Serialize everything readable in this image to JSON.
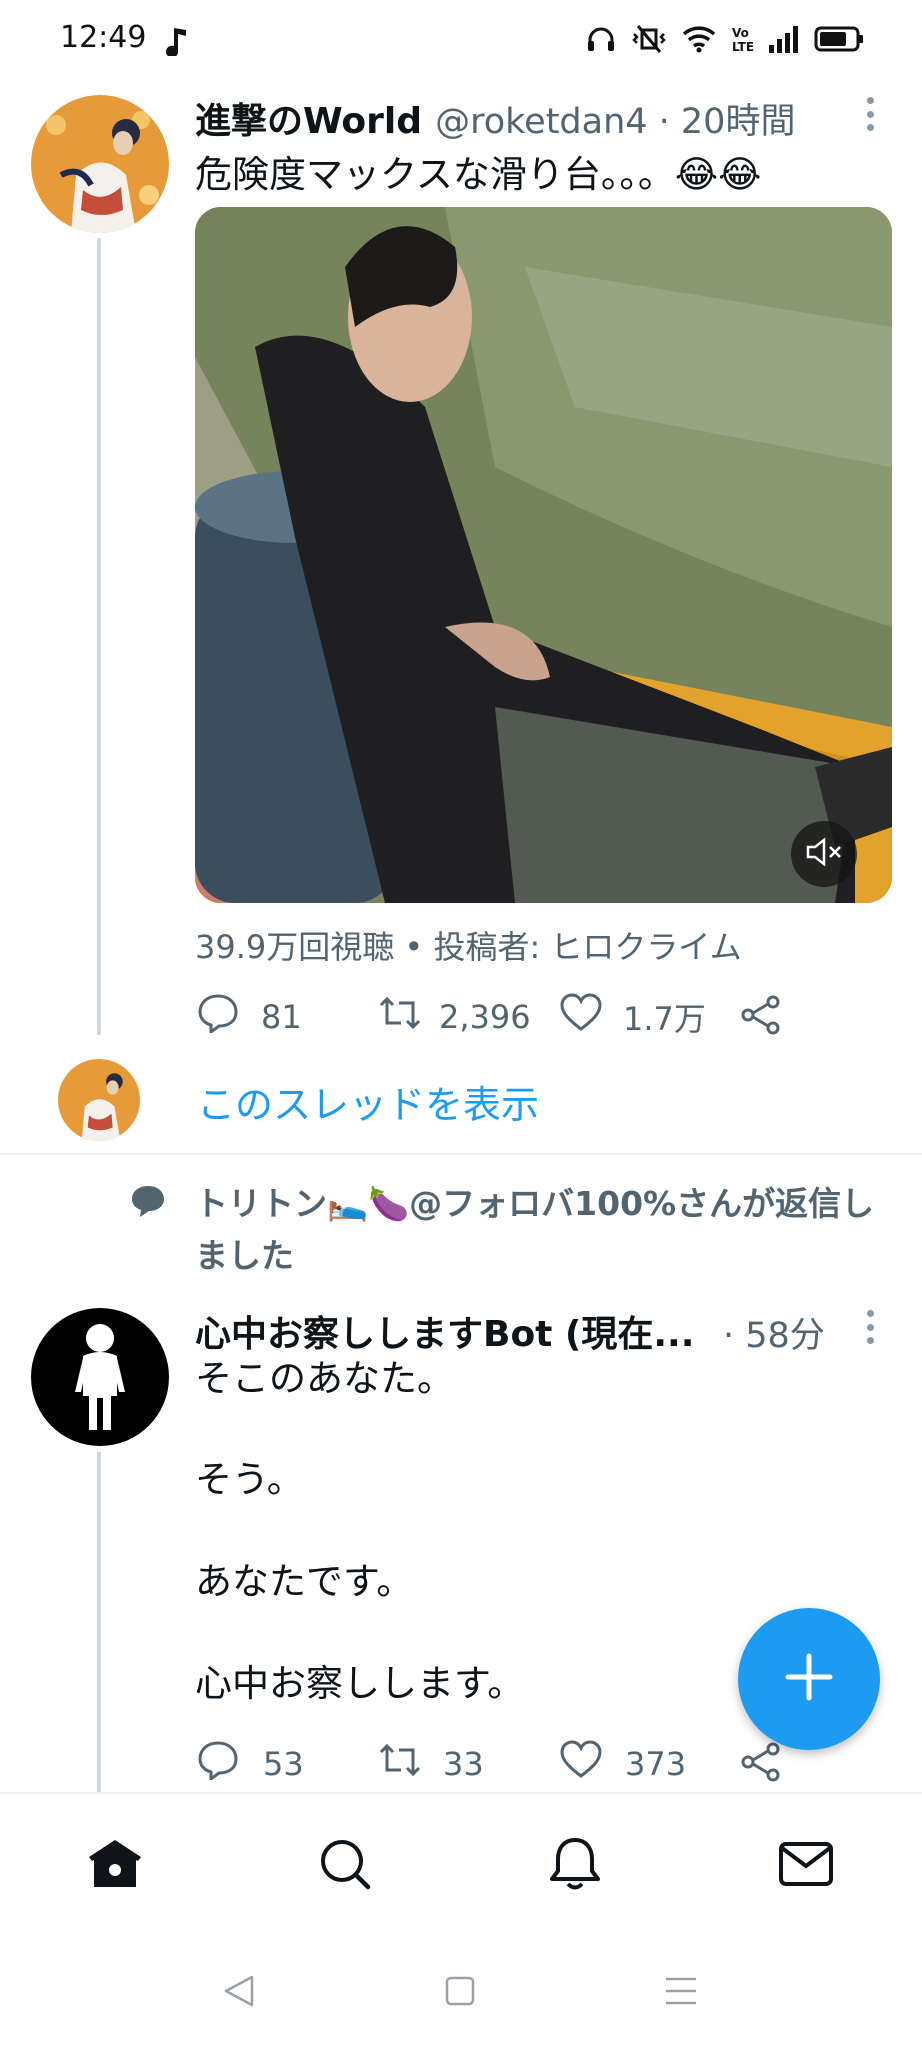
{
  "status_bar": {
    "time": "12:49",
    "icons": [
      "music-note-icon",
      "headphones-icon",
      "vibrate-off-icon",
      "wifi-icon",
      "volte-icon",
      "signal-icon",
      "battery-icon"
    ]
  },
  "tweet1": {
    "author_name": "進撃のWorld",
    "handle": "@roketdan4",
    "time": "· 20時間",
    "text": "危険度マックスな滑り台。。。😂😂",
    "views": "39.9万回視聴 • 投稿者: ヒロクライム",
    "replies": "81",
    "retweets": "2,396",
    "likes": "1.7万",
    "show_thread": "このスレッドを表示"
  },
  "reply_note": "トリトン🛌🍆@フォロバ100%さんが返信しました",
  "tweet2": {
    "author_name": "心中お察ししますBot (現在...",
    "time": "· 58分",
    "lines": [
      "そこのあなた。",
      "そう。",
      "あなたです。",
      "心中お察しします。"
    ],
    "replies": "53",
    "retweets": "33",
    "likes": "373"
  },
  "fab": {
    "icon": "plus-icon"
  },
  "bottom_nav": [
    "home-icon",
    "search-icon",
    "notifications-icon",
    "messages-icon"
  ],
  "system_nav": [
    "back-icon",
    "recents-icon",
    "menu-icon"
  ],
  "colors": {
    "accent": "#1d9bf0",
    "secondary_text": "#536471",
    "thread_line": "#cfd9de"
  }
}
